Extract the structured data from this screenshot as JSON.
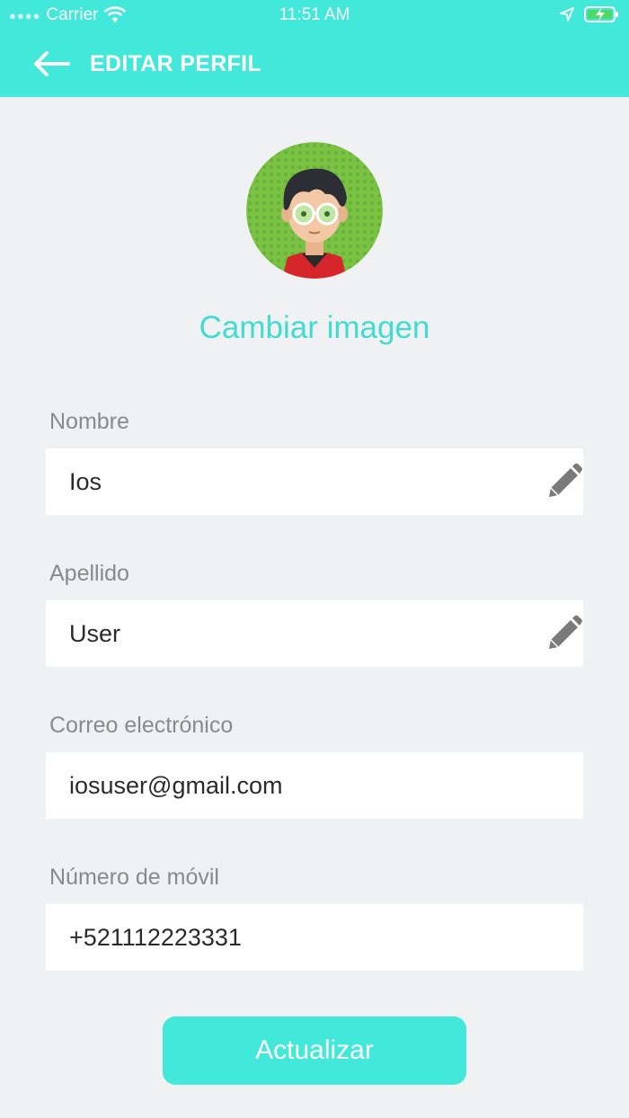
{
  "status_bar": {
    "carrier": "Carrier",
    "time": "11:51 AM"
  },
  "header": {
    "title": "EDITAR PERFIL",
    "back_icon": "arrow-left-icon"
  },
  "profile": {
    "change_image_label": "Cambiar imagen"
  },
  "fields": [
    {
      "label": "Nombre",
      "value": "Ios",
      "editable": true
    },
    {
      "label": "Apellido",
      "value": "User",
      "editable": true
    },
    {
      "label": "Correo electrónico",
      "value": "iosuser@gmail.com",
      "editable": false
    },
    {
      "label": "Número de móvil",
      "value": "+521112223331",
      "editable": false
    }
  ],
  "actions": {
    "update_label": "Actualizar"
  },
  "colors": {
    "accent": "#42e8d9",
    "background": "#f0f1f3",
    "label": "#8a8a8a",
    "icon": "#7a7a7a"
  }
}
